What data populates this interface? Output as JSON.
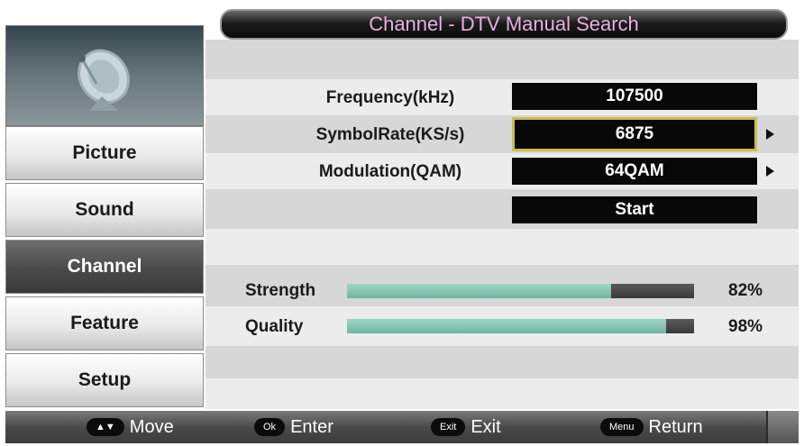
{
  "title": "Channel - DTV Manual Search",
  "sidebar": {
    "logo_icon": "satellite-dish-icon",
    "items": [
      {
        "label": "Picture",
        "active": false
      },
      {
        "label": "Sound",
        "active": false
      },
      {
        "label": "Channel",
        "active": true
      },
      {
        "label": "Feature",
        "active": false
      },
      {
        "label": "Setup",
        "active": false
      }
    ]
  },
  "params": [
    {
      "label": "Frequency(kHz)",
      "value": "107500"
    },
    {
      "label": "SymbolRate(KS/s)",
      "value": "6875"
    },
    {
      "label": "Modulation(QAM)",
      "value": "64QAM"
    }
  ],
  "start_label": "Start",
  "signal": {
    "strength": {
      "label": "Strength",
      "percent_text": "82%",
      "level": 0.76
    },
    "quality": {
      "label": "Quality",
      "percent_text": "98%",
      "level": 0.92
    }
  },
  "footer": {
    "move": {
      "key": "▲▼",
      "label": "Move"
    },
    "enter": {
      "key": "Ok",
      "label": "Enter"
    },
    "exit": {
      "key": "Exit",
      "label": "Exit"
    },
    "return": {
      "key": "Menu",
      "label": "Return"
    }
  },
  "colors": {
    "title_text": "#e7b0e0",
    "selected_border": "#c7c04a",
    "bar_fill": "#6fb6a1",
    "bar_track": "#3a3a3a"
  }
}
